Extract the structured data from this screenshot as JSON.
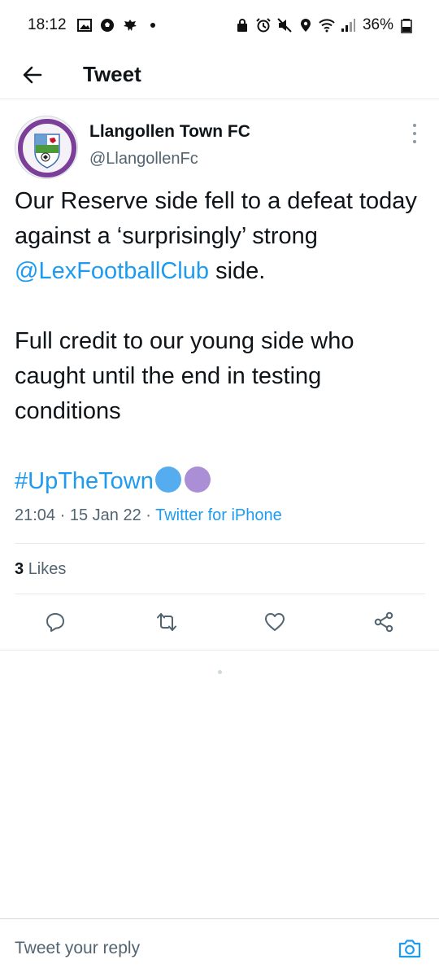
{
  "status_bar": {
    "time": "18:12",
    "battery": "36%",
    "left_icons": [
      "image-icon",
      "football-icon",
      "eagle-icon",
      "dot-icon"
    ],
    "right_icons": [
      "lock-icon",
      "alarm-icon",
      "mute-icon",
      "location-icon",
      "wifi-icon",
      "signal-icon",
      "battery-icon"
    ]
  },
  "header": {
    "title": "Tweet"
  },
  "tweet": {
    "author_name": "Llangollen Town FC",
    "author_handle": "@LlangollenFc",
    "body": {
      "line1_pre": "Our Reserve side fell to a defeat today against a ‘surprisingly’ strong ",
      "mention": "@LexFootballClub",
      "line1_post": " side.",
      "paragraph2": "Full credit to our young side who caught until the end in testing conditions",
      "hashtag": "#UpTheTown"
    },
    "time": "21:04",
    "date": "15 Jan 22",
    "source": "Twitter for iPhone",
    "separator": " · ",
    "likes_count": "3",
    "likes_label": "Likes"
  },
  "reply": {
    "placeholder": "Tweet your reply"
  },
  "colors": {
    "accent": "#1d9bf0",
    "muted": "#536471",
    "circle_blue": "#55acee",
    "circle_purple": "#aa8ed6"
  }
}
